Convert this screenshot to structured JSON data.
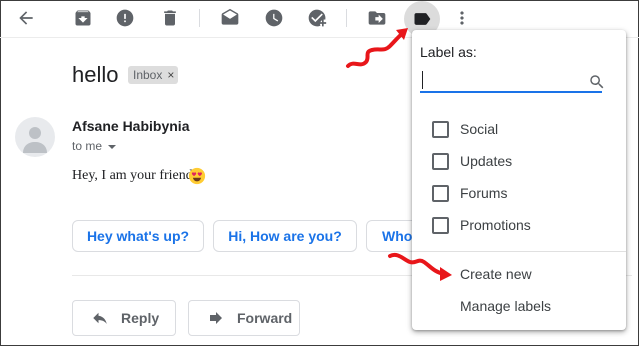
{
  "toolbar": {
    "icons": [
      "back-arrow-icon",
      "archive-icon",
      "report-spam-icon",
      "delete-icon",
      "mark-unread-icon",
      "snooze-icon",
      "add-to-tasks-icon",
      "move-to-icon",
      "labels-icon",
      "more-icon"
    ]
  },
  "email": {
    "subject": "hello",
    "label_chip": "Inbox",
    "label_chip_close": "×",
    "sender": "Afsane Habibynia",
    "recipient": "to me",
    "body": "Hey, I am your friend.",
    "emoji": "heart-eyes-emoji"
  },
  "smart_replies": [
    "Hey what's up?",
    "Hi, How are you?",
    "Who"
  ],
  "actions": {
    "reply": "Reply",
    "forward": "Forward"
  },
  "label_menu": {
    "title": "Label as:",
    "search_value": "",
    "options": [
      {
        "label": "Social",
        "checked": false
      },
      {
        "label": "Updates",
        "checked": false
      },
      {
        "label": "Forums",
        "checked": false
      },
      {
        "label": "Promotions",
        "checked": false
      }
    ],
    "create_new": "Create new",
    "manage_labels": "Manage labels"
  },
  "colors": {
    "accent": "#1a73e8",
    "annotation_arrow": "#e8161a",
    "active_icon_bg": "#dcdcdc"
  }
}
